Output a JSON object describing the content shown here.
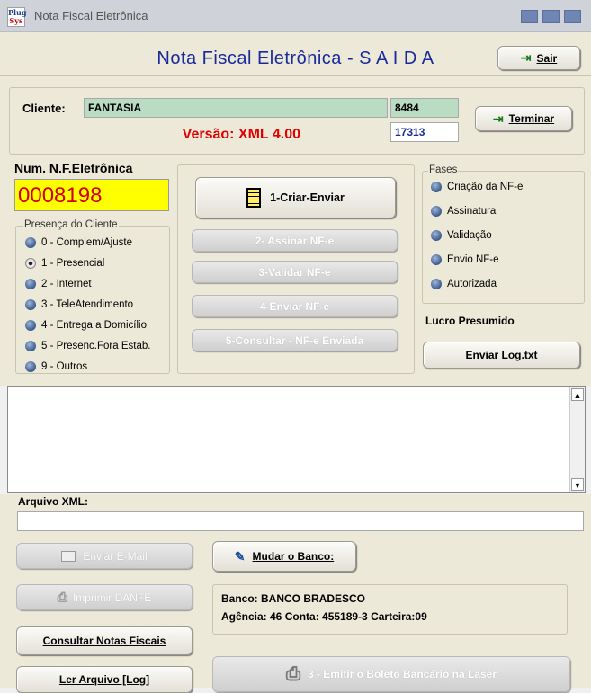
{
  "window": {
    "title": "Nota Fiscal Eletrônica",
    "logo_top": "Plug",
    "logo_bottom": "Sys"
  },
  "header": {
    "title": "Nota Fiscal Eletrônica - S A I D A",
    "sair_label": "Sair"
  },
  "cliente": {
    "label": "Cliente:",
    "name": "FANTASIA",
    "code": "8484",
    "number2": "17313",
    "versao": "Versão: XML 4.00",
    "terminar_label": "Terminar"
  },
  "nf": {
    "label": "Num. N.F.Eletrônica",
    "number": "0008198"
  },
  "presenca": {
    "legend": "Presença do Cliente",
    "selected": 1,
    "options": [
      "0 - Complem/Ajuste",
      "1 - Presencial",
      "2 - Internet",
      "3 - TeleAtendimento",
      "4 - Entrega a Domicílio",
      "5 - Presenc.Fora Estab.",
      "9 - Outros"
    ]
  },
  "actions": {
    "criar": "1-Criar-Enviar",
    "assinar": "2- Assinar NF-e",
    "validar": "3-Validar NF-e",
    "enviar": "4-Enviar NF-e",
    "consultar": "5-Consultar - NF-e Enviada"
  },
  "fases": {
    "legend": "Fases",
    "items": [
      "Criação da NF-e",
      "Assinatura",
      "Validação",
      "Envio NF-e",
      "Autorizada"
    ]
  },
  "lucro": "Lucro Presumido",
  "enviar_log": "Enviar Log.txt",
  "arquivo": {
    "label": "Arquivo XML:",
    "value": ""
  },
  "bottom": {
    "email": "Enviar E-Mail",
    "imprimir": "Imprimir DANFE",
    "consultar_notas": "Consultar Notas Fiscais",
    "ler_arquivo": "Ler Arquivo [Log]",
    "mudar_banco": "Mudar o Banco:",
    "boleto": "3 - Emitir o Boleto Bancário na Laser"
  },
  "banco": {
    "line1": "Banco: BANCO BRADESCO",
    "line2": "Agência: 46 Conta: 455189-3 Carteira:09"
  },
  "colors": {
    "title_blue": "#1a2a9a",
    "versao_red": "#e00000",
    "nf_yellow": "#ffff00",
    "nf_red": "#d40000",
    "cliente_green": "#b9dcc2"
  }
}
